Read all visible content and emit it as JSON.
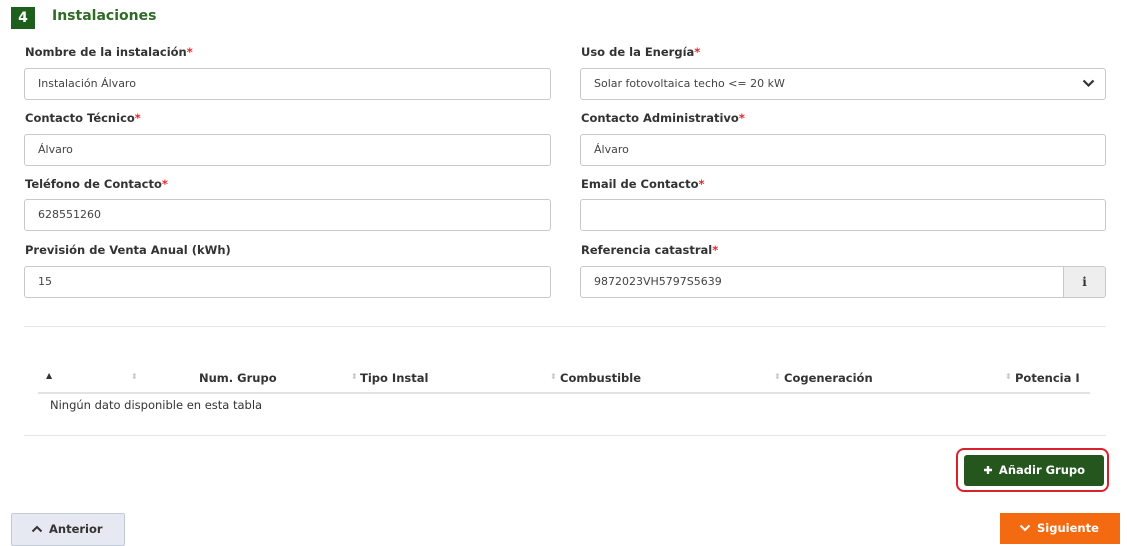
{
  "section": {
    "number": "4",
    "title": "Instalaciones"
  },
  "required_mark": "*",
  "form": {
    "nombre": {
      "label": "Nombre de la instalación",
      "value": "Instalación Álvaro"
    },
    "uso": {
      "label": "Uso de la Energía",
      "value": "Solar fotovoltaica techo <= 20 kW"
    },
    "contacto_tecnico": {
      "label": "Contacto Técnico",
      "value": "Álvaro"
    },
    "contacto_admin": {
      "label": "Contacto Administrativo",
      "value": "Álvaro"
    },
    "telefono": {
      "label": "Teléfono de Contacto",
      "value": "628551260"
    },
    "email": {
      "label": "Email de Contacto",
      "value": ""
    },
    "prevision": {
      "label": "Previsión de Venta Anual (kWh)",
      "value": "15"
    },
    "referencia": {
      "label": "Referencia catastral",
      "value": "9872023VH5797S5639",
      "info_glyph": "i"
    }
  },
  "table": {
    "columns": [
      "Num. Grupo",
      "Tipo Instal",
      "Combustible",
      "Cogeneración",
      "Potencia I"
    ],
    "empty_message": "Ningún dato disponible en esta tabla"
  },
  "buttons": {
    "add_group": "Añadir Grupo",
    "previous": "Anterior",
    "next": "Siguiente"
  },
  "colors": {
    "section_badge": "#1d5f1d",
    "section_title": "#2e6b25",
    "required": "#e4292b",
    "add_button": "#25561e",
    "highlight_outline": "#d9222b",
    "next_button": "#f46a10",
    "previous_button": "#e6e9f1"
  },
  "icons": {
    "plus": "plus-icon",
    "chevron_up": "chevron-up-icon",
    "chevron_down": "chevron-down-icon",
    "info": "info-icon",
    "sort": "sort-icon",
    "sort_asc": "sort-asc-icon"
  }
}
